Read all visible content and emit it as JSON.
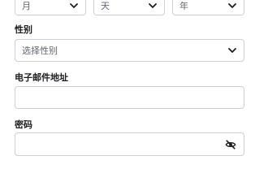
{
  "birthday": {
    "month_value": "月",
    "day_value": "天",
    "year_value": "年"
  },
  "gender": {
    "label": "性别",
    "placeholder": "选择性别"
  },
  "email": {
    "label": "电子邮件地址",
    "value": ""
  },
  "password": {
    "label": "密码",
    "value": ""
  },
  "icons": {
    "dropdown": "chevron-down-icon",
    "toggle_visibility": "eye-slash-icon"
  }
}
